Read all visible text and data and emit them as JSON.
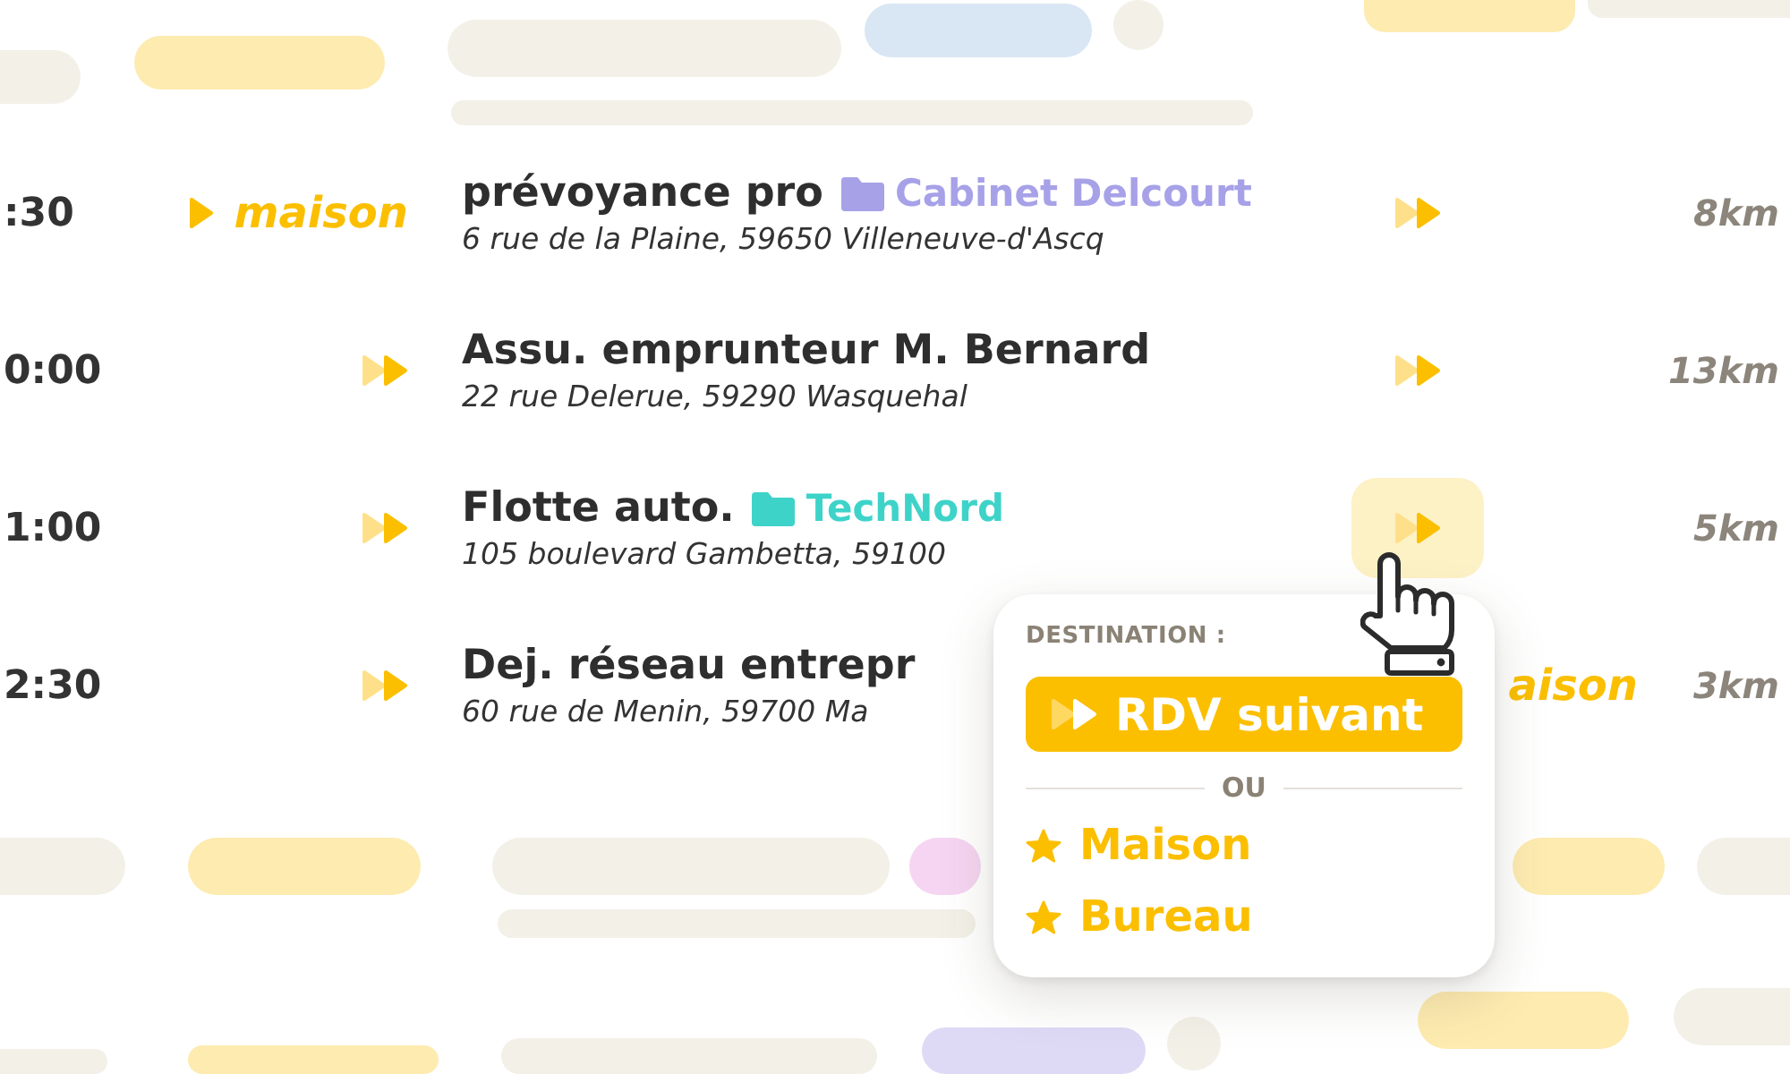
{
  "rows": [
    {
      "time": ":30",
      "from": {
        "kind": "place",
        "label": "maison"
      },
      "title": "prévoyance pro",
      "tag": {
        "label": "Cabinet Delcourt",
        "color": "#a7a1e8"
      },
      "address": "6 rue de la Plaine, 59650 Villeneuve-d'Ascq",
      "to": {
        "kind": "next",
        "hovered": false
      },
      "distance": "8km"
    },
    {
      "time": "0:00",
      "from": {
        "kind": "next"
      },
      "title": "Assu. emprunteur M. Bernard",
      "address": "22 rue Delerue, 59290 Wasquehal",
      "to": {
        "kind": "next",
        "hovered": false
      },
      "distance": "13km"
    },
    {
      "time": "1:00",
      "from": {
        "kind": "next"
      },
      "title": "Flotte auto.",
      "tag": {
        "label": "TechNord",
        "color": "#3ed3c9"
      },
      "address": "105 boulevard Gambetta, 59100",
      "to": {
        "kind": "next",
        "hovered": true
      },
      "distance": "5km"
    },
    {
      "time": "2:30",
      "from": {
        "kind": "next"
      },
      "title": "Dej. réseau entrepr",
      "address": "60 rue de Menin, 59700 Ma",
      "to": {
        "kind": "label",
        "label": "aison",
        "hovered": false
      },
      "distance": "3km"
    }
  ],
  "destination_popup": {
    "heading": "DESTINATION :",
    "primary_button": {
      "label": "RDV suivant"
    },
    "divider": "OU",
    "options": [
      {
        "label": "Maison"
      },
      {
        "label": "Bureau"
      }
    ]
  }
}
